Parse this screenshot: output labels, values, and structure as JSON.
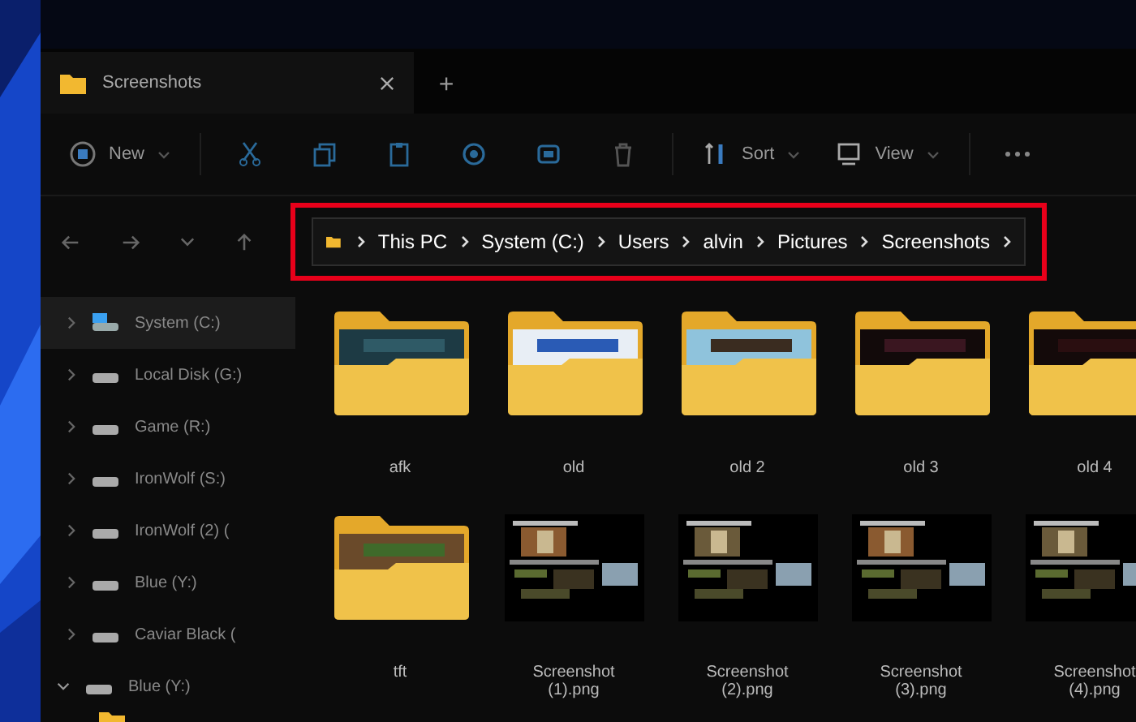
{
  "tabs": [
    {
      "title": "Screenshots",
      "selected": true
    }
  ],
  "new_tab": "+",
  "toolbar": {
    "new": "New",
    "sort": "Sort",
    "view": "View"
  },
  "address": {
    "highlighted": true,
    "crumbs": [
      "This PC",
      "System (C:)",
      "Users",
      "alvin",
      "Pictures",
      "Screenshots"
    ]
  },
  "sidebar": {
    "items": [
      {
        "label": "System (C:)",
        "selected": true,
        "expanded": false,
        "kind": "system"
      },
      {
        "label": "Local Disk (G:)",
        "selected": false,
        "expanded": false,
        "kind": "drive"
      },
      {
        "label": "Game (R:)",
        "selected": false,
        "expanded": false,
        "kind": "drive"
      },
      {
        "label": "IronWolf (S:)",
        "selected": false,
        "expanded": false,
        "kind": "drive"
      },
      {
        "label": "IronWolf (2) (",
        "selected": false,
        "expanded": false,
        "kind": "drive"
      },
      {
        "label": "Blue (Y:)",
        "selected": false,
        "expanded": false,
        "kind": "drive"
      },
      {
        "label": "Caviar Black (",
        "selected": false,
        "expanded": false,
        "kind": "drive"
      },
      {
        "label": "Blue (Y:)",
        "selected": false,
        "expanded": true,
        "kind": "drive"
      }
    ]
  },
  "items": [
    {
      "name": "afk",
      "kind": "folder"
    },
    {
      "name": "old",
      "kind": "folder"
    },
    {
      "name": "old 2",
      "kind": "folder"
    },
    {
      "name": "old 3",
      "kind": "folder"
    },
    {
      "name": "old 4",
      "kind": "folder"
    },
    {
      "name": "tft",
      "kind": "folder"
    },
    {
      "name": "Screenshot (1).png"
    },
    {
      "name": "Screenshot (2).png"
    },
    {
      "name": "Screenshot (3).png"
    },
    {
      "name": "Screenshot (4).png"
    }
  ]
}
